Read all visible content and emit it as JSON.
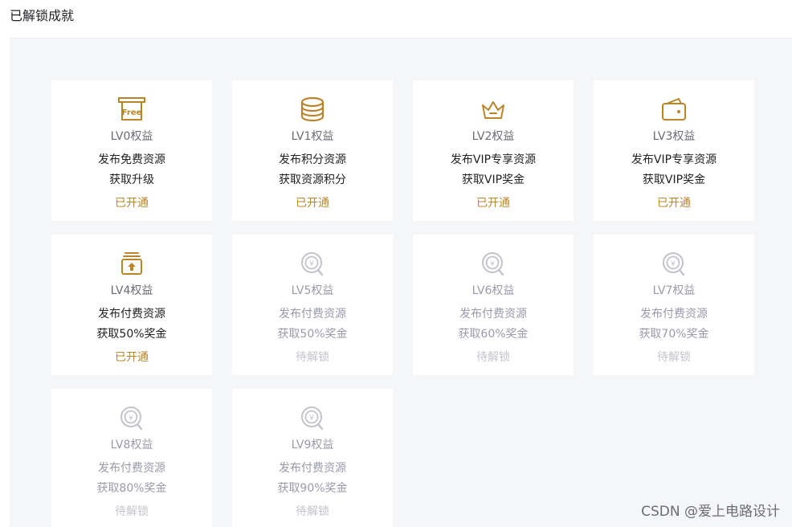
{
  "page": {
    "title": "已解锁成就"
  },
  "colors": {
    "gold": "#b8852a",
    "locked": "#c2c3cc",
    "panel": "#f5f6f7"
  },
  "cards": [
    {
      "level": "LV0权益",
      "line1": "发布免费资源",
      "line2": "获取升级",
      "status": "已开通",
      "icon": "free-badge-icon"
    },
    {
      "level": "LV1权益",
      "line1": "发布积分资源",
      "line2": "获取资源积分",
      "status": "已开通",
      "icon": "coin-stack-icon"
    },
    {
      "level": "LV2权益",
      "line1": "发布VIP专享资源",
      "line2": "获取VIP奖金",
      "status": "已开通",
      "icon": "crown-icon"
    },
    {
      "level": "LV3权益",
      "line1": "发布VIP专享资源",
      "line2": "获取VIP奖金",
      "status": "已开通",
      "icon": "wallet-icon"
    },
    {
      "level": "LV4权益",
      "line1": "发布付费资源",
      "line2": "获取50%奖金",
      "status": "已开通",
      "icon": "upload-box-icon"
    },
    {
      "level": "LV5权益",
      "line1": "发布付费资源",
      "line2": "获取50%奖金",
      "status": "待解锁",
      "icon": "locked-coin-icon"
    },
    {
      "level": "LV6权益",
      "line1": "发布付费资源",
      "line2": "获取60%奖金",
      "status": "待解锁",
      "icon": "locked-coin-icon"
    },
    {
      "level": "LV7权益",
      "line1": "发布付费资源",
      "line2": "获取70%奖金",
      "status": "待解锁",
      "icon": "locked-coin-icon"
    },
    {
      "level": "LV8权益",
      "line1": "发布付费资源",
      "line2": "获取80%奖金",
      "status": "待解锁",
      "icon": "locked-coin-icon"
    },
    {
      "level": "LV9权益",
      "line1": "发布付费资源",
      "line2": "获取90%奖金",
      "status": "待解锁",
      "icon": "locked-coin-icon"
    }
  ],
  "watermark": "CSDN @爱上电路设计"
}
